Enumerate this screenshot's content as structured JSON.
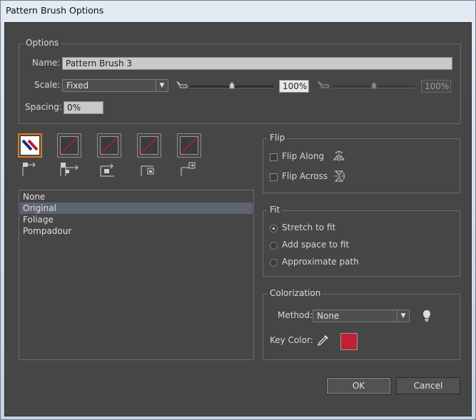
{
  "window": {
    "title": "Pattern Brush Options"
  },
  "options": {
    "legend": "Options",
    "name_label": "Name:",
    "name_value": "Pattern Brush 3",
    "scale_label": "Scale:",
    "scale_value": "Fixed",
    "scale_min_percent": "100%",
    "scale_max_percent": "100%",
    "spacing_label": "Spacing:",
    "spacing_value": "0%"
  },
  "tiles": {
    "pattern_list": [
      "None",
      "Original",
      "Foliage",
      "Pompadour"
    ],
    "selected_index": 1
  },
  "flip": {
    "legend": "Flip",
    "along_label": "Flip Along",
    "across_label": "Flip Across"
  },
  "fit": {
    "legend": "Fit",
    "options": [
      "Stretch to fit",
      "Add space to fit",
      "Approximate path"
    ],
    "selected_index": 0
  },
  "colorization": {
    "legend": "Colorization",
    "method_label": "Method:",
    "method_value": "None",
    "key_color_label": "Key Color:",
    "key_color": "#c21f35"
  },
  "buttons": {
    "ok": "OK",
    "cancel": "Cancel"
  },
  "colors": {
    "accent_selected_tile": "#e07b20",
    "tile_slash": "#b51f2f"
  }
}
